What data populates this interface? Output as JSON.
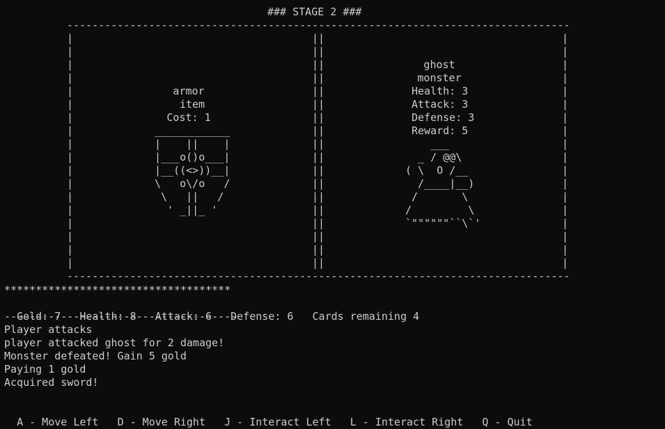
{
  "header": {
    "stage_title": "### STAGE 2 ###"
  },
  "board": {
    "border_char_top": "-",
    "left_card": {
      "name": "armor",
      "type": "item",
      "cost_text": "Cost: 1",
      "art": [
        "____________",
        "|    ||    |",
        "|___o()o___|",
        "|__((<>))__|",
        "\\   o\\/o   /",
        " \\   ||   /",
        "  ' _||_ '"
      ]
    },
    "right_card": {
      "name": "ghost",
      "type": "monster",
      "health_text": "Health: 3",
      "attack_text": "Attack: 3",
      "defense_text": "Defense: 3",
      "reward_text": "Reward: 5",
      "art": [
        "    ___",
        "  _ / @@\\",
        "( \\  O /__",
        "  /____|__)",
        " /       \\",
        "/         \\",
        "`\"\"\"\"\"\"``\\`'"
      ]
    }
  },
  "status": {
    "stars": "************************************",
    "gold": "Gold: 7",
    "health": "Health: 8",
    "attack": "Attack: 6",
    "defense": "Defense: 6",
    "cards_remaining": "Cards remaining 4",
    "dashes": "-------------------------------------"
  },
  "log": [
    "Player attacks",
    "player attacked ghost for 2 damage!",
    "Monster defeated! Gain 5 gold",
    "Paying 1 gold",
    "Acquired sword!"
  ],
  "controls": [
    {
      "key_label": "A - Move Left"
    },
    {
      "key_label": "D - Move Right"
    },
    {
      "key_label": "J - Interact Left"
    },
    {
      "key_label": "L - Interact Right"
    },
    {
      "key_label": "Q - Quit"
    }
  ],
  "colors": {
    "background": "#0c0c0c",
    "text": "#cccccc"
  }
}
